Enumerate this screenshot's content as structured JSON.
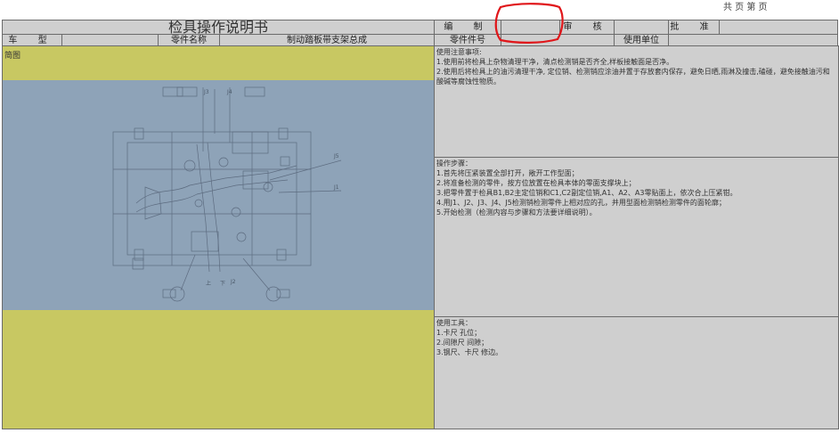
{
  "sheet_label": "共 页   第 页",
  "header": {
    "title": "检具操作说明书",
    "compile_label": "编 制",
    "compile_value": "",
    "review_label": "审 核",
    "review_value": "",
    "approve_label": "批 准",
    "approve_value": ""
  },
  "row2": {
    "car_type_label": "车 型",
    "car_type_value": "",
    "part_name_label": "零件名称",
    "part_name_value": "制动踏板带支架总成",
    "part_no_label": "零件件号",
    "part_no_value": "",
    "unit_label": "使用单位",
    "unit_value": ""
  },
  "diagram_label": "简图",
  "notes": {
    "title": "使用注意事项:",
    "lines": [
      "1.使用前将检具上杂物清理干净，清点检测销是否齐全,样板接触面是否净。",
      "2.使用后将检具上的油污清理干净, 定位销、检测销应涂油并置于存放套内保存，避免日晒,雨淋及撞击,磕碰，避免接触油污和酸碱等腐蚀性物质。"
    ]
  },
  "steps": {
    "title": "操作步骤：",
    "lines": [
      "1.首先将压紧装置全部打开，敞开工作型面；",
      "2.将准备检测的零件，按方位放置在检具本体的零面支撑块上；",
      "3.把零件置于检具B1,B2主定位销和C1,C2副定位销,A1、A2、A3零贴面上，依次合上压紧钳。",
      "4.用J1、J2、J3、J4、J5检测销检测零件上相对应的孔，并用型面检测销检测零件的面轮廓；",
      "5.开始检测（检测内容与步骤和方法要详细说明）。"
    ]
  },
  "tools": {
    "title": "使用工具：",
    "lines": [
      "1.卡尺        孔位；",
      "2.间隙尺       间隙；",
      "3.钢尺、卡尺    修边。"
    ]
  },
  "drawing_labels": {
    "j1": "J1",
    "j2": "J2",
    "j3": "J3",
    "j4": "J4",
    "j5": "J5",
    "s1": "上",
    "s2": "下"
  },
  "colors": {
    "yellow": "#c8c862",
    "blue_panel": "#8ea3b8",
    "cell_gray": "#cfcfcf",
    "annotation_red": "#e0161a"
  }
}
